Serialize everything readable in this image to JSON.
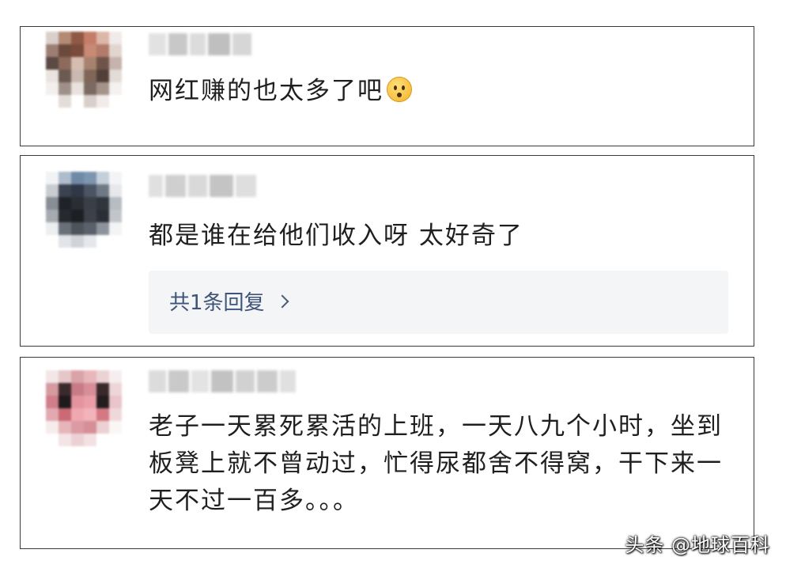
{
  "comments": [
    {
      "text": "网红赚的也太多了吧",
      "emoji": "surprised-emoji"
    },
    {
      "text": "都是谁在给他们收入呀 太好奇了",
      "reply_label": "共1条回复"
    },
    {
      "text": "老子一天累死累活的上班，一天八九个小时，坐到板凳上就不曾动过，忙得尿都舍不得窝，干下来一天不过一百多。。。"
    }
  ],
  "watermark": "头条 @地球百科",
  "colors": {
    "card_border": "#3a3a3a",
    "reply_background": "#f4f5f7",
    "reply_text": "#3e5478"
  }
}
